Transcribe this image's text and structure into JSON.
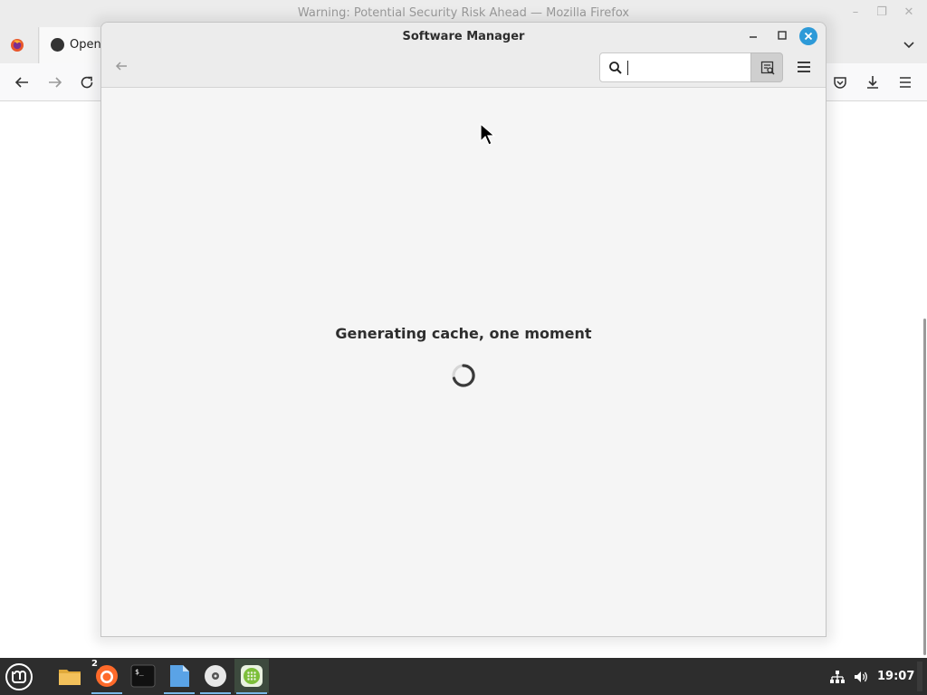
{
  "firefox": {
    "window_title": "Warning: Potential Security Risk Ahead — Mozilla Firefox",
    "tab_label": "Open"
  },
  "software_manager": {
    "title": "Software Manager",
    "search": {
      "value": "",
      "placeholder": ""
    },
    "status_message": "Generating cache, one moment"
  },
  "taskbar": {
    "apps": [
      {
        "name": "Files",
        "icon": "folder-icon"
      },
      {
        "name": "Firefox",
        "icon": "firefox-icon",
        "window_count": "2"
      },
      {
        "name": "Terminal",
        "icon": "terminal-icon"
      },
      {
        "name": "Document",
        "icon": "document-icon"
      },
      {
        "name": "Disc",
        "icon": "disc-icon"
      },
      {
        "name": "Software Manager",
        "icon": "software-manager-icon"
      }
    ],
    "clock": "19:07"
  },
  "colors": {
    "accent": "#2d9ad8",
    "taskbar_bg": "#2d2d2d",
    "window_bg": "#f5f5f5"
  }
}
